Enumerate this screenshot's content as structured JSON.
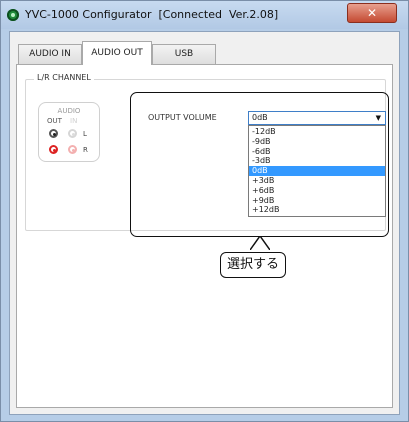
{
  "window": {
    "title": "YVC-1000 Configurator  [Connected  Ver.2.08]",
    "close_label": "✕"
  },
  "tabs": [
    {
      "label": "AUDIO IN",
      "active": false
    },
    {
      "label": "AUDIO OUT",
      "active": true
    },
    {
      "label": "USB",
      "active": false
    }
  ],
  "section": {
    "label": "L/R CHANNEL"
  },
  "audio_panel": {
    "title": "AUDIO",
    "out_label": "OUT",
    "in_label": "IN",
    "left_label": "L",
    "right_label": "R"
  },
  "output_volume": {
    "label": "OUTPUT VOLUME",
    "value": "0dB",
    "options": [
      "-12dB",
      "-9dB",
      "-6dB",
      "-3dB",
      "0dB",
      "+3dB",
      "+6dB",
      "+9dB",
      "+12dB"
    ],
    "selected_index": 4
  },
  "annotation": {
    "text": "選択する"
  },
  "colors": {
    "selection": "#3399ff",
    "red_jack": "#dd2222",
    "title_bar": "#b6cde7"
  }
}
